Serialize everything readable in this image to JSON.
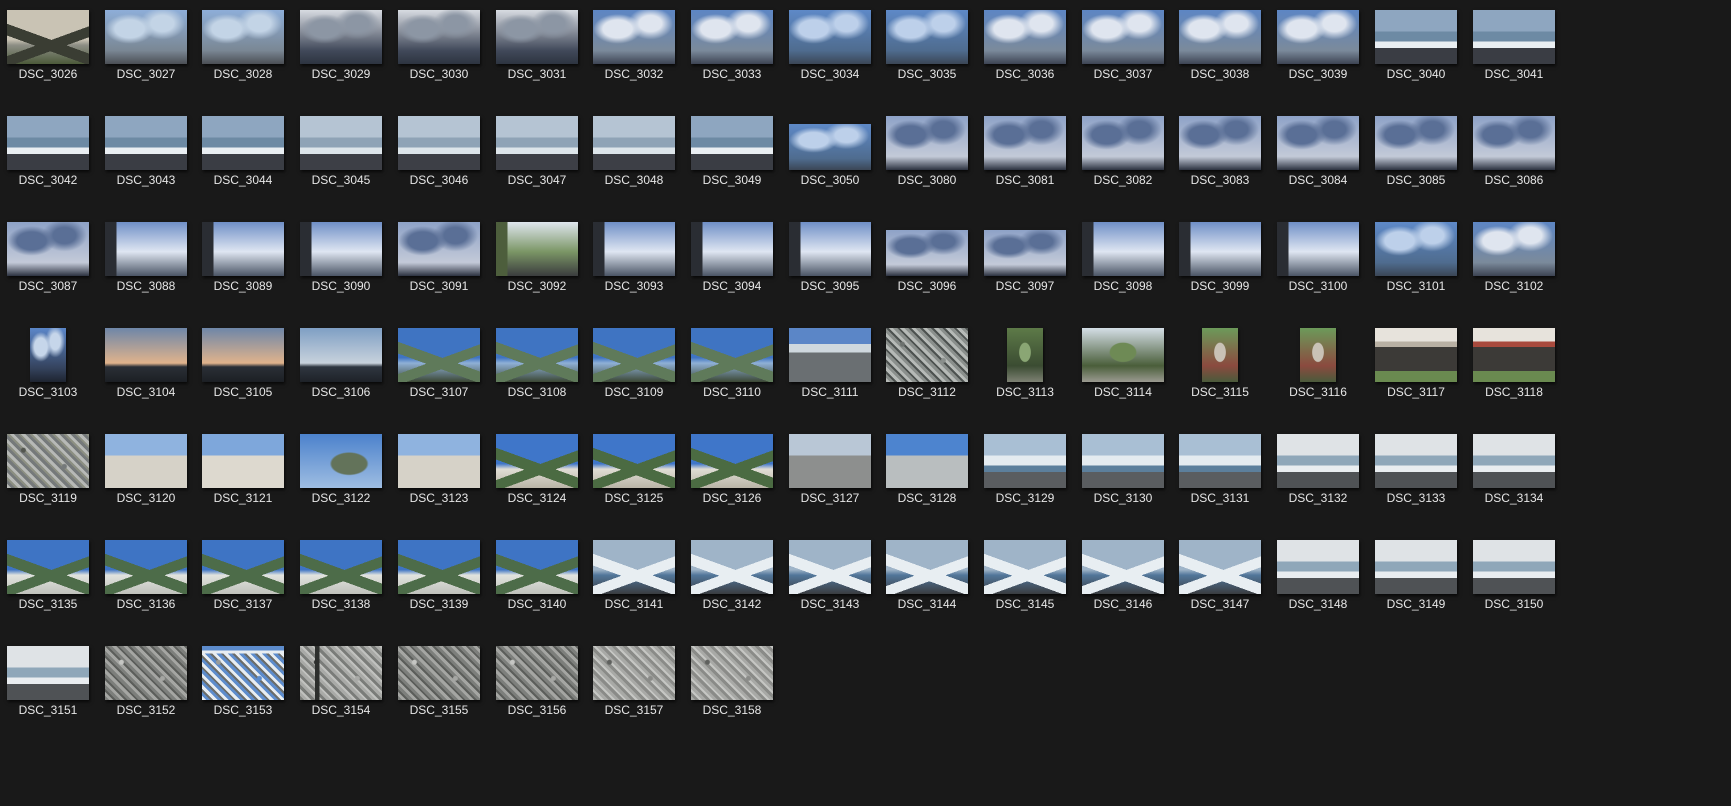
{
  "window": {
    "background": "#191919",
    "caption_color": "#e6e6e6"
  },
  "thumbnails": [
    {
      "name": "DSC_3026",
      "orientation": "landscape",
      "scene": "mountain-dusk"
    },
    {
      "name": "DSC_3027",
      "orientation": "landscape",
      "scene": "beach-sky"
    },
    {
      "name": "DSC_3028",
      "orientation": "landscape",
      "scene": "beach-sky"
    },
    {
      "name": "DSC_3029",
      "orientation": "landscape",
      "scene": "storm-clouds"
    },
    {
      "name": "DSC_3030",
      "orientation": "landscape",
      "scene": "storm-clouds"
    },
    {
      "name": "DSC_3031",
      "orientation": "landscape",
      "scene": "storm-clouds"
    },
    {
      "name": "DSC_3032",
      "orientation": "landscape",
      "scene": "cloudy-sky"
    },
    {
      "name": "DSC_3033",
      "orientation": "landscape",
      "scene": "cloudy-sky"
    },
    {
      "name": "DSC_3034",
      "orientation": "landscape",
      "scene": "blue-sky-sea"
    },
    {
      "name": "DSC_3035",
      "orientation": "landscape",
      "scene": "blue-sky-sea"
    },
    {
      "name": "DSC_3036",
      "orientation": "landscape",
      "scene": "cloudy-sky"
    },
    {
      "name": "DSC_3037",
      "orientation": "landscape",
      "scene": "cloudy-sky"
    },
    {
      "name": "DSC_3038",
      "orientation": "landscape",
      "scene": "cloudy-sky"
    },
    {
      "name": "DSC_3039",
      "orientation": "landscape",
      "scene": "cloudy-sky"
    },
    {
      "name": "DSC_3040",
      "orientation": "landscape",
      "scene": "waves"
    },
    {
      "name": "DSC_3041",
      "orientation": "landscape",
      "scene": "waves"
    },
    {
      "name": "DSC_3042",
      "orientation": "landscape",
      "scene": "waves"
    },
    {
      "name": "DSC_3043",
      "orientation": "landscape",
      "scene": "waves"
    },
    {
      "name": "DSC_3044",
      "orientation": "landscape",
      "scene": "waves"
    },
    {
      "name": "DSC_3045",
      "orientation": "landscape",
      "scene": "misty-coast"
    },
    {
      "name": "DSC_3046",
      "orientation": "landscape",
      "scene": "misty-coast"
    },
    {
      "name": "DSC_3047",
      "orientation": "landscape",
      "scene": "misty-coast"
    },
    {
      "name": "DSC_3048",
      "orientation": "landscape",
      "scene": "misty-coast"
    },
    {
      "name": "DSC_3049",
      "orientation": "landscape",
      "scene": "waves"
    },
    {
      "name": "DSC_3050",
      "orientation": "landscape-small",
      "scene": "blue-sky-sea"
    },
    {
      "name": "DSC_3080",
      "orientation": "landscape",
      "scene": "dark-clouds"
    },
    {
      "name": "DSC_3081",
      "orientation": "landscape",
      "scene": "dark-clouds"
    },
    {
      "name": "DSC_3082",
      "orientation": "landscape",
      "scene": "dark-clouds"
    },
    {
      "name": "DSC_3083",
      "orientation": "landscape",
      "scene": "dark-clouds"
    },
    {
      "name": "DSC_3084",
      "orientation": "landscape",
      "scene": "dark-clouds"
    },
    {
      "name": "DSC_3085",
      "orientation": "landscape",
      "scene": "dark-clouds"
    },
    {
      "name": "DSC_3086",
      "orientation": "landscape",
      "scene": "dark-clouds"
    },
    {
      "name": "DSC_3087",
      "orientation": "landscape",
      "scene": "dark-clouds"
    },
    {
      "name": "DSC_3088",
      "orientation": "landscape",
      "scene": "building-sky"
    },
    {
      "name": "DSC_3089",
      "orientation": "landscape",
      "scene": "building-sky"
    },
    {
      "name": "DSC_3090",
      "orientation": "landscape",
      "scene": "building-sky"
    },
    {
      "name": "DSC_3091",
      "orientation": "landscape",
      "scene": "dark-clouds"
    },
    {
      "name": "DSC_3092",
      "orientation": "landscape",
      "scene": "balcony-green"
    },
    {
      "name": "DSC_3093",
      "orientation": "landscape",
      "scene": "building-sky"
    },
    {
      "name": "DSC_3094",
      "orientation": "landscape",
      "scene": "building-sky"
    },
    {
      "name": "DSC_3095",
      "orientation": "landscape",
      "scene": "building-sky"
    },
    {
      "name": "DSC_3096",
      "orientation": "landscape-small",
      "scene": "dark-clouds"
    },
    {
      "name": "DSC_3097",
      "orientation": "landscape-small",
      "scene": "dark-clouds"
    },
    {
      "name": "DSC_3098",
      "orientation": "landscape",
      "scene": "building-sky"
    },
    {
      "name": "DSC_3099",
      "orientation": "landscape",
      "scene": "building-sky"
    },
    {
      "name": "DSC_3100",
      "orientation": "landscape",
      "scene": "building-sky"
    },
    {
      "name": "DSC_3101",
      "orientation": "landscape",
      "scene": "blue-sky-sea"
    },
    {
      "name": "DSC_3102",
      "orientation": "landscape",
      "scene": "cloudy-sky"
    },
    {
      "name": "DSC_3103",
      "orientation": "portrait",
      "scene": "portrait-sky"
    },
    {
      "name": "DSC_3104",
      "orientation": "landscape",
      "scene": "sunset"
    },
    {
      "name": "DSC_3105",
      "orientation": "landscape",
      "scene": "sunset"
    },
    {
      "name": "DSC_3106",
      "orientation": "landscape",
      "scene": "sunset-blue"
    },
    {
      "name": "DSC_3107",
      "orientation": "landscape",
      "scene": "mountain-clear"
    },
    {
      "name": "DSC_3108",
      "orientation": "landscape",
      "scene": "mountain-clear"
    },
    {
      "name": "DSC_3109",
      "orientation": "landscape",
      "scene": "mountain-clear"
    },
    {
      "name": "DSC_3110",
      "orientation": "landscape",
      "scene": "mountain-clear"
    },
    {
      "name": "DSC_3111",
      "orientation": "landscape",
      "scene": "parking-lot"
    },
    {
      "name": "DSC_3112",
      "orientation": "landscape",
      "scene": "grass-paving"
    },
    {
      "name": "DSC_3113",
      "orientation": "portrait",
      "scene": "forest-house"
    },
    {
      "name": "DSC_3114",
      "orientation": "landscape",
      "scene": "forest-path"
    },
    {
      "name": "DSC_3115",
      "orientation": "portrait",
      "scene": "gazebo"
    },
    {
      "name": "DSC_3116",
      "orientation": "portrait",
      "scene": "gazebo"
    },
    {
      "name": "DSC_3117",
      "orientation": "landscape",
      "scene": "shelter"
    },
    {
      "name": "DSC_3118",
      "orientation": "landscape",
      "scene": "shelter-red"
    },
    {
      "name": "DSC_3119",
      "orientation": "landscape",
      "scene": "driftwood"
    },
    {
      "name": "DSC_3120",
      "orientation": "landscape",
      "scene": "dunes"
    },
    {
      "name": "DSC_3121",
      "orientation": "landscape",
      "scene": "dunes-plant"
    },
    {
      "name": "DSC_3122",
      "orientation": "landscape",
      "scene": "tree-sky"
    },
    {
      "name": "DSC_3123",
      "orientation": "landscape",
      "scene": "dunes"
    },
    {
      "name": "DSC_3124",
      "orientation": "landscape",
      "scene": "mountain-sand"
    },
    {
      "name": "DSC_3125",
      "orientation": "landscape",
      "scene": "mountain-sand"
    },
    {
      "name": "DSC_3126",
      "orientation": "landscape",
      "scene": "mountain-sand"
    },
    {
      "name": "DSC_3127",
      "orientation": "landscape",
      "scene": "pebbles-sky"
    },
    {
      "name": "DSC_3128",
      "orientation": "landscape",
      "scene": "pebbles-blue"
    },
    {
      "name": "DSC_3129",
      "orientation": "landscape",
      "scene": "surf-pebbles"
    },
    {
      "name": "DSC_3130",
      "orientation": "landscape",
      "scene": "surf-pebbles"
    },
    {
      "name": "DSC_3131",
      "orientation": "landscape",
      "scene": "surf-pebbles"
    },
    {
      "name": "DSC_3132",
      "orientation": "landscape",
      "scene": "pale-sea"
    },
    {
      "name": "DSC_3133",
      "orientation": "landscape",
      "scene": "pale-sea"
    },
    {
      "name": "DSC_3134",
      "orientation": "landscape",
      "scene": "pale-sea"
    },
    {
      "name": "DSC_3135",
      "orientation": "landscape",
      "scene": "mountain-beach"
    },
    {
      "name": "DSC_3136",
      "orientation": "landscape",
      "scene": "mountain-beach"
    },
    {
      "name": "DSC_3137",
      "orientation": "landscape",
      "scene": "mountain-beach"
    },
    {
      "name": "DSC_3138",
      "orientation": "landscape",
      "scene": "mountain-beach"
    },
    {
      "name": "DSC_3139",
      "orientation": "landscape",
      "scene": "mountain-beach"
    },
    {
      "name": "DSC_3140",
      "orientation": "landscape",
      "scene": "mountain-beach"
    },
    {
      "name": "DSC_3141",
      "orientation": "landscape",
      "scene": "coast-mountain-surf"
    },
    {
      "name": "DSC_3142",
      "orientation": "landscape",
      "scene": "coast-mountain-surf"
    },
    {
      "name": "DSC_3143",
      "orientation": "landscape",
      "scene": "coast-mountain-surf"
    },
    {
      "name": "DSC_3144",
      "orientation": "landscape",
      "scene": "coast-mountain-surf"
    },
    {
      "name": "DSC_3145",
      "orientation": "landscape",
      "scene": "coast-mountain-surf"
    },
    {
      "name": "DSC_3146",
      "orientation": "landscape",
      "scene": "coast-mountain-surf"
    },
    {
      "name": "DSC_3147",
      "orientation": "landscape",
      "scene": "coast-mountain-surf"
    },
    {
      "name": "DSC_3148",
      "orientation": "landscape",
      "scene": "pale-sea"
    },
    {
      "name": "DSC_3149",
      "orientation": "landscape",
      "scene": "pale-sea"
    },
    {
      "name": "DSC_3150",
      "orientation": "landscape",
      "scene": "pale-sea"
    },
    {
      "name": "DSC_3151",
      "orientation": "landscape",
      "scene": "pale-sea"
    },
    {
      "name": "DSC_3152",
      "orientation": "landscape",
      "scene": "gravel"
    },
    {
      "name": "DSC_3153",
      "orientation": "landscape",
      "scene": "gravel-sea"
    },
    {
      "name": "DSC_3154",
      "orientation": "landscape",
      "scene": "gravel-shadow"
    },
    {
      "name": "DSC_3155",
      "orientation": "landscape",
      "scene": "gravel"
    },
    {
      "name": "DSC_3156",
      "orientation": "landscape",
      "scene": "gravel"
    },
    {
      "name": "DSC_3157",
      "orientation": "landscape",
      "scene": "gravel-close"
    },
    {
      "name": "DSC_3158",
      "orientation": "landscape",
      "scene": "gravel-close"
    }
  ],
  "scene_palettes": {
    "mountain-dusk": [
      "#c9c3b4",
      "#8d8e85",
      "#3a3d33",
      "#4c5a3a"
    ],
    "beach-sky": [
      "#8eaed8",
      "#c3d4e6",
      "#7a8794",
      "#4b4f55"
    ],
    "storm-clouds": [
      "#d7dbe1",
      "#8c96a4",
      "#41495a",
      "#2d3440"
    ],
    "cloudy-sky": [
      "#5d86c4",
      "#dfe5ef",
      "#7b8a9b",
      "#3d4453"
    ],
    "blue-sky-sea": [
      "#5e89c7",
      "#bdd0ea",
      "#4f6c8f",
      "#3b4656"
    ],
    "waves": [
      "#8ea6c0",
      "#6d8aa4",
      "#e9eef2",
      "#3a3d44"
    ],
    "misty-coast": [
      "#b5c4d3",
      "#8fa3b6",
      "#dde5ea",
      "#3d3f46"
    ],
    "dark-clouds": [
      "#8ea2c7",
      "#5a6f96",
      "#c3cad8",
      "#2c3240"
    ],
    "building-sky": [
      "#6f8fc6",
      "#dfe6f2",
      "#2a2d33",
      "#4b5566"
    ],
    "balcony-green": [
      "#dfe6ee",
      "#7b9666",
      "#4d5e3c",
      "#3a3c3e"
    ],
    "portrait-sky": [
      "#5b86c8",
      "#c6d6ea",
      "#34425c",
      "#1e2430"
    ],
    "sunset": [
      "#6e86a8",
      "#e0b38c",
      "#2a2f36",
      "#1c1f24"
    ],
    "sunset-blue": [
      "#7f9fc4",
      "#c8d2dc",
      "#2f3640",
      "#1e2228"
    ],
    "mountain-clear": [
      "#3f74c2",
      "#8fb0d6",
      "#5f7a5a",
      "#3b4734"
    ],
    "parking-lot": [
      "#5b86c7",
      "#cfd8de",
      "#6a6f72",
      "#3a4043"
    ],
    "grass-paving": [
      "#8a8f8c",
      "#b6bab7",
      "#6c716e",
      "#4d5250"
    ],
    "forest-house": [
      "#5d7a48",
      "#8aa674",
      "#3b4c32",
      "#7d8173"
    ],
    "forest-path": [
      "#d4dee6",
      "#6e8a55",
      "#4a5e3a",
      "#9a9a90"
    ],
    "gazebo": [
      "#6c9a5a",
      "#c9c2b6",
      "#8b4a3f",
      "#4a5a3b"
    ],
    "shelter": [
      "#e7e3dc",
      "#b8b0a3",
      "#3c3a37",
      "#6a8a50"
    ],
    "shelter-red": [
      "#e7e3dc",
      "#a84a3d",
      "#3c3a37",
      "#6a8a50"
    ],
    "driftwood": [
      "#75797a",
      "#b7b9b6",
      "#53564f",
      "#8c8f82"
    ],
    "dunes": [
      "#8fb3df",
      "#d6d2c8",
      "#a9a69d",
      "#6d7a5d"
    ],
    "dunes-plant": [
      "#7ea7db",
      "#ddd9cf",
      "#4e7040",
      "#b4b0a5"
    ],
    "tree-sky": [
      "#4c82cc",
      "#9ebde2",
      "#63735a",
      "#a0a7a0"
    ],
    "mountain-sand": [
      "#3f76c9",
      "#e0ddd4",
      "#4b6b42",
      "#b9b4a6"
    ],
    "pebbles-sky": [
      "#b9c7d6",
      "#8d8f8e",
      "#5e6162",
      "#a4a6a4"
    ],
    "pebbles-blue": [
      "#4d84cf",
      "#b9bebf",
      "#7a7e80",
      "#a2a6a8"
    ],
    "surf-pebbles": [
      "#a9bfd4",
      "#e4ebf0",
      "#5c7f9c",
      "#5a5d60"
    ],
    "pale-sea": [
      "#dfe3e6",
      "#8fa7b9",
      "#e9edf0",
      "#4f5255"
    ],
    "mountain-beach": [
      "#3e74c4",
      "#e1e3de",
      "#4d6c49",
      "#bfc1bb"
    ],
    "coast-mountain-surf": [
      "#9fb4c8",
      "#52769a",
      "#e8eef2",
      "#3a3c40"
    ],
    "gravel": [
      "#a5a6a3",
      "#7d7f7c",
      "#c5c6c3",
      "#5c5e5b"
    ],
    "gravel-sea": [
      "#5d8ccc",
      "#e8edf1",
      "#9a9c99",
      "#6b6d6a"
    ],
    "gravel-shadow": [
      "#a9aaa7",
      "#7a7c79",
      "#2c2e2c",
      "#c0c1be"
    ],
    "gravel-close": [
      "#8a8b88",
      "#a8a9a6",
      "#5f615e",
      "#c5c6c3"
    ]
  }
}
